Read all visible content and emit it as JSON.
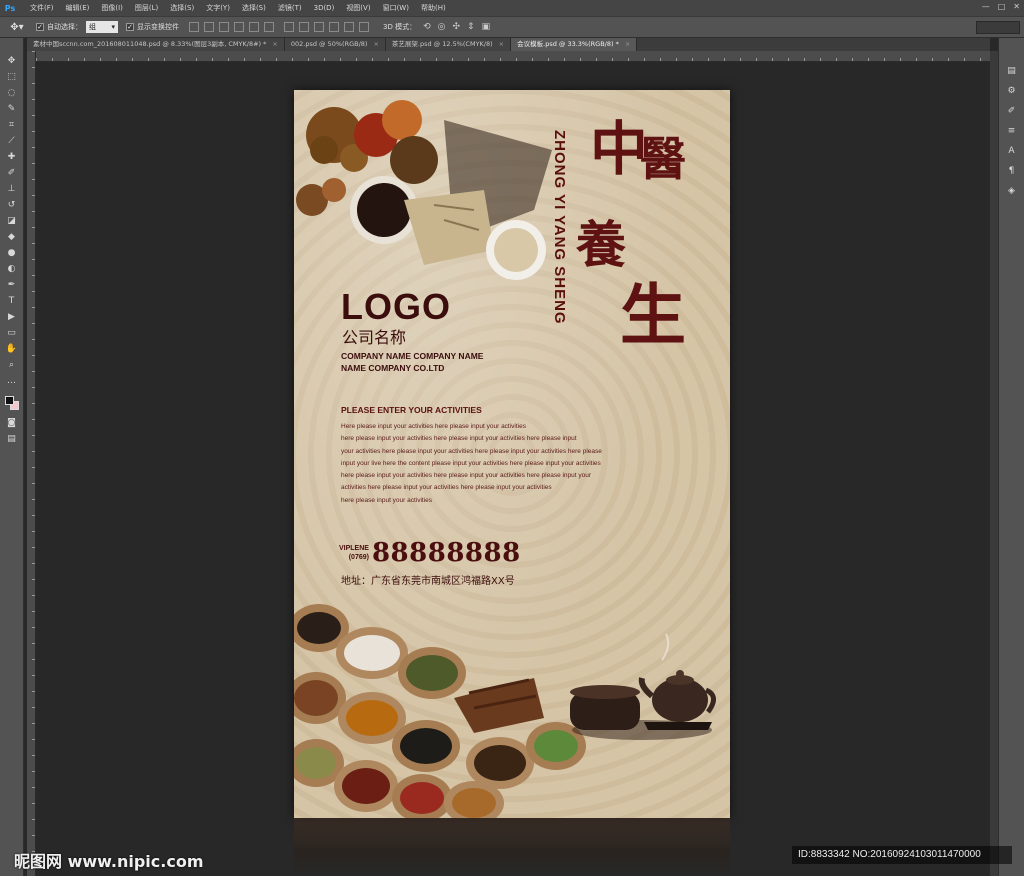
{
  "app": {
    "logo": "Ps"
  },
  "menu": [
    "文件(F)",
    "编辑(E)",
    "图像(I)",
    "图层(L)",
    "选择(S)",
    "文字(Y)",
    "选择(S)",
    "滤镜(T)",
    "3D(D)",
    "视图(V)",
    "窗口(W)",
    "帮助(H)"
  ],
  "window_controls": {
    "minimize": "—",
    "maximize": "□",
    "close": "✕"
  },
  "options": {
    "tool_icon": "move-tool-icon",
    "auto_select_label": "自动选择：",
    "auto_select_value": "组",
    "show_transform_label": "显示变换控件",
    "mode_3d_label": "3D 模式：",
    "workspace": ""
  },
  "tabs": [
    {
      "label": "素材中国sccnn.com_201608011048.psd @ 8.33%(图层3副本, CMYK/8#) *",
      "active": false
    },
    {
      "label": "002.psd @ 50%(RGB/8)",
      "active": false
    },
    {
      "label": "茶艺展架.psd @ 12.5%(CMYK/8)",
      "active": false
    },
    {
      "label": "会议模板.psd @ 33.3%(RGB/8) *",
      "active": true
    }
  ],
  "tab_close": "×",
  "poster": {
    "pinyin": "ZHONG YI YANG SHENG",
    "calligraphy": [
      "中",
      "醫",
      "養",
      "生"
    ],
    "logo": "LOGO",
    "company_cn": "公司名称",
    "company_en_1": "COMPANY NAME COMPANY NAME",
    "company_en_2": "NAME COMPANY CO.LTD",
    "activities_title": "PLEASE ENTER YOUR ACTIVITIES",
    "activities_lines": [
      "Here please input your activities here please input your activities",
      "here please input your activities here please input your activities here please input",
      "your activities here please input your activities here please input your activities here please",
      "input your live here the content please input your activities here please input your activities",
      "here please input your activities here please input your activities here please input your",
      "activities here please input your activities here please input your activities",
      "here please input your activities"
    ],
    "phone_label_1": "VIPLENE",
    "phone_label_2": "(0769)",
    "phone": "88888888",
    "address": "地址：广东省东莞市南城区鸿福路XX号"
  },
  "watermark": {
    "left": "昵图网 www.nipic.com",
    "right": "ID:8833342 NO:20160924103011470000"
  },
  "colors": {
    "poster_bg": "#d5c4a6",
    "title_red": "#5e1212",
    "text_dark": "#3b0d0d",
    "ps_blue": "#31a8ff"
  }
}
